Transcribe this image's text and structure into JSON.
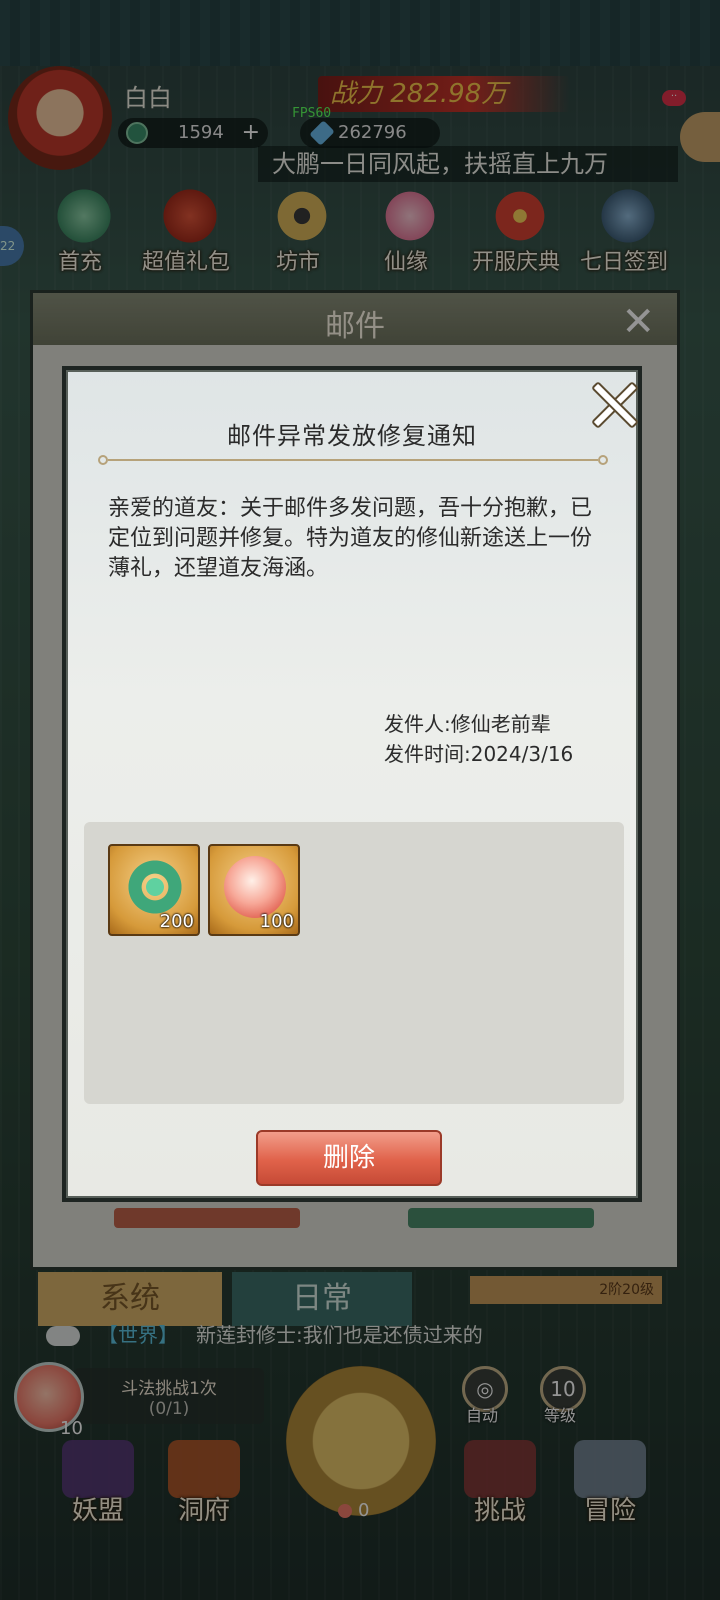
{
  "header": {
    "username": "白白",
    "power": "战力 282.98万",
    "jade_count": "1594",
    "gem_count": "262796",
    "fps": "FPS60",
    "motto": "大鹏一日同风起，扶摇直上九万"
  },
  "menu": [
    {
      "label": "首充",
      "icon": "first-recharge-icon"
    },
    {
      "label": "超值礼包",
      "icon": "gift-bag-icon"
    },
    {
      "label": "坊市",
      "icon": "market-icon"
    },
    {
      "label": "仙缘",
      "icon": "lotus-icon"
    },
    {
      "label": "开服庆典",
      "icon": "gift-box-icon"
    },
    {
      "label": "七日签到",
      "icon": "signin-icon"
    }
  ],
  "side_badge": "22",
  "mail_panel": {
    "title": "邮件",
    "tabs": [
      "系统",
      "日常"
    ],
    "level_text": "2阶20级"
  },
  "chat": {
    "tag": "【世界】",
    "message": "新莲封修士:我们也是还债过来的"
  },
  "bottom": {
    "task_title": "斗法挑战1次",
    "task_progress": "(0/1)",
    "peach_count": "10",
    "auto_label": "自动",
    "level_value": "10",
    "level_label": "等级",
    "center_count": "0",
    "nav": [
      "妖盟",
      "洞府",
      "挑战",
      "冒险"
    ]
  },
  "dialog": {
    "title": "邮件异常发放修复通知",
    "body": "亲爱的道友：关于邮件多发问题，吾十分抱歉，已定位到问题并修复。特为道友的修仙新途送上一份薄礼，还望道友海涵。",
    "sender": "发件人:修仙老前辈",
    "time": "发件时间:2024/3/16",
    "attachments": [
      {
        "name": "jade-ring",
        "count": "200"
      },
      {
        "name": "peach",
        "count": "100"
      }
    ],
    "delete_label": "删除"
  }
}
